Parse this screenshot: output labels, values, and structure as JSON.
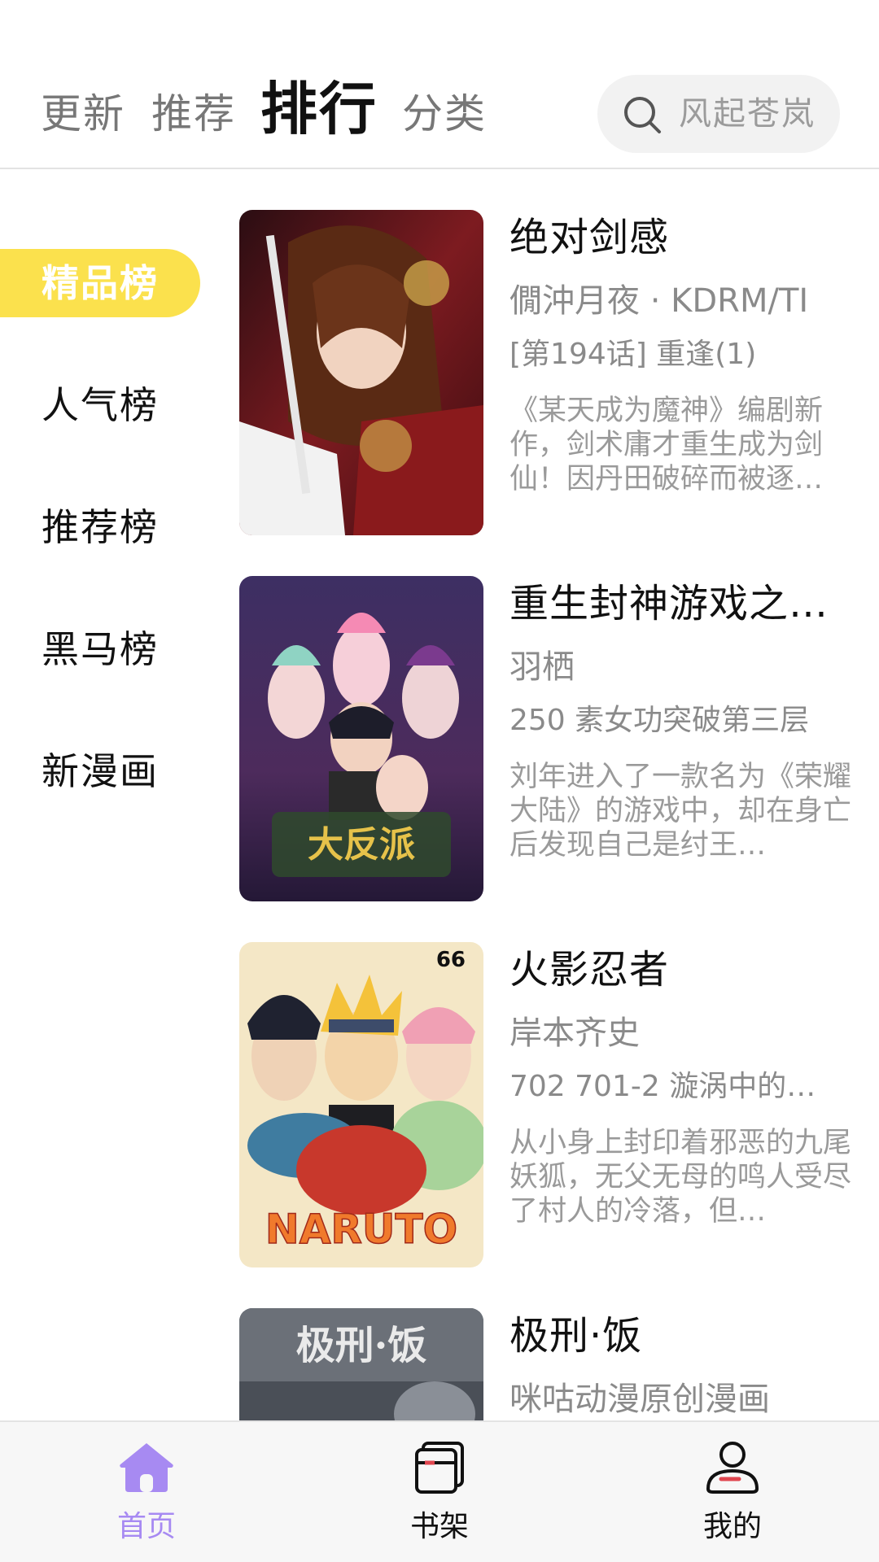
{
  "header": {
    "tabs": [
      {
        "label": "更新",
        "active": false
      },
      {
        "label": "推荐",
        "active": false
      },
      {
        "label": "排行",
        "active": true
      },
      {
        "label": "分类",
        "active": false
      }
    ],
    "search": {
      "icon": "search-icon",
      "placeholder": "风起苍岚"
    }
  },
  "rank_nav": {
    "items": [
      {
        "label": "精品榜",
        "active": true
      },
      {
        "label": "人气榜",
        "active": false
      },
      {
        "label": "推荐榜",
        "active": false
      },
      {
        "label": "黑马榜",
        "active": false
      },
      {
        "label": "新漫画",
        "active": false
      }
    ]
  },
  "comics": [
    {
      "title": "绝对剑感",
      "author": "僩沖月夜 · KDRM/TI",
      "chapter": "[第194话] 重逢(1)",
      "description": "《某天成为魔神》编剧新作，剑术庸才重生成为剑仙！因丹田破碎而被逐…"
    },
    {
      "title": "重生封神游戏之…",
      "author": "羽栖",
      "chapter": "250 素女功突破第三层",
      "description": "刘年进入了一款名为《荣耀大陆》的游戏中，却在身亡后发现自己是纣王…"
    },
    {
      "title": "火影忍者",
      "author": "岸本齐史",
      "chapter": "702 701-2 漩涡中的…",
      "description": "从小身上封印着邪恶的九尾妖狐，无父无母的鸣人受尽了村人的冷落，但…"
    },
    {
      "title": "极刑·饭",
      "author": "咪咕动漫原创漫画",
      "chapter": "",
      "description": ""
    }
  ],
  "bottom_nav": {
    "items": [
      {
        "label": "首页",
        "icon": "home-icon",
        "active": true
      },
      {
        "label": "书架",
        "icon": "bookshelf-icon",
        "active": false
      },
      {
        "label": "我的",
        "icon": "profile-icon",
        "active": false
      }
    ]
  },
  "colors": {
    "accent_yellow": "#fbe14d",
    "active_purple": "#a78af2"
  }
}
